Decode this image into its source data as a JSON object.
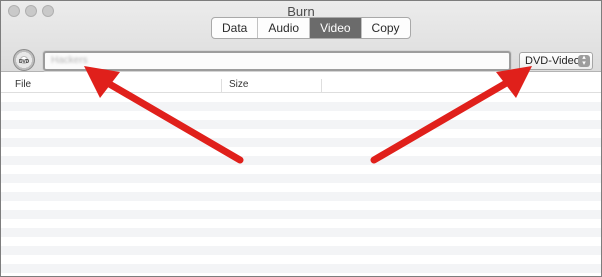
{
  "window": {
    "title": "Burn"
  },
  "tabs": [
    {
      "label": "Data",
      "active": false
    },
    {
      "label": "Audio",
      "active": false
    },
    {
      "label": "Video",
      "active": true
    },
    {
      "label": "Copy",
      "active": false
    }
  ],
  "disc": {
    "icon": "dvd-disc-icon",
    "label": "DVD"
  },
  "name_field": {
    "value": "Hackers"
  },
  "format_select": {
    "selected": "DVD-Video"
  },
  "file_list": {
    "columns": [
      "File",
      "Size"
    ],
    "rows": []
  },
  "annotations": {
    "arrow_color": "#e0201b"
  }
}
